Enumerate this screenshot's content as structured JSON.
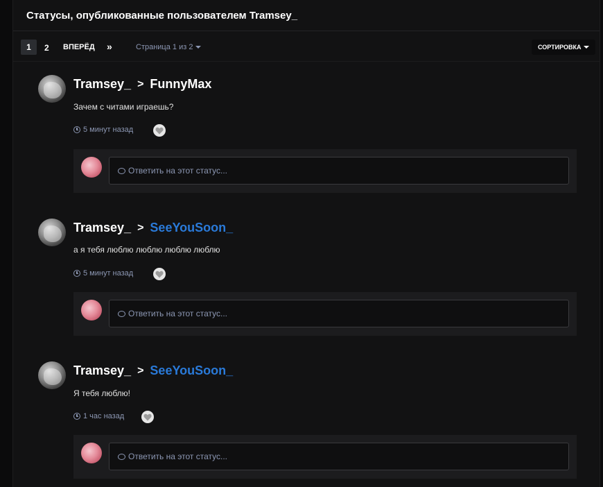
{
  "header": {
    "title": "Статусы, опубликованные пользователем Tramsey_"
  },
  "pagination": {
    "current": "1",
    "page2": "2",
    "next_label": "ВПЕРЁД",
    "last_label": "»",
    "status": "Страница 1 из 2"
  },
  "sort": {
    "label": "СОРТИРОВКА"
  },
  "colors": {
    "accent_blue": "#2a7ad9",
    "background": "#121213",
    "muted": "#8c97b3"
  },
  "statuses": [
    {
      "author": "Tramsey_",
      "separator": ">",
      "target": "FunnyMax",
      "target_color": "white",
      "message": "Зачем с читами играешь?",
      "time": "5 минут назад",
      "reply_placeholder": "Ответить на этот статус..."
    },
    {
      "author": "Tramsey_",
      "separator": ">",
      "target": "SeeYouSoon_",
      "target_color": "blue",
      "message": "а я тебя люблю люблю люблю люблю",
      "time": "5 минут назад",
      "reply_placeholder": "Ответить на этот статус..."
    },
    {
      "author": "Tramsey_",
      "separator": ">",
      "target": "SeeYouSoon_",
      "target_color": "blue",
      "message": "Я тебя люблю!",
      "time": "1 час назад",
      "reply_placeholder": "Ответить на этот статус..."
    }
  ],
  "icons": [
    "clock-icon",
    "heart-icon",
    "comment-icon",
    "chevron-right-icon",
    "caret-down-icon"
  ]
}
